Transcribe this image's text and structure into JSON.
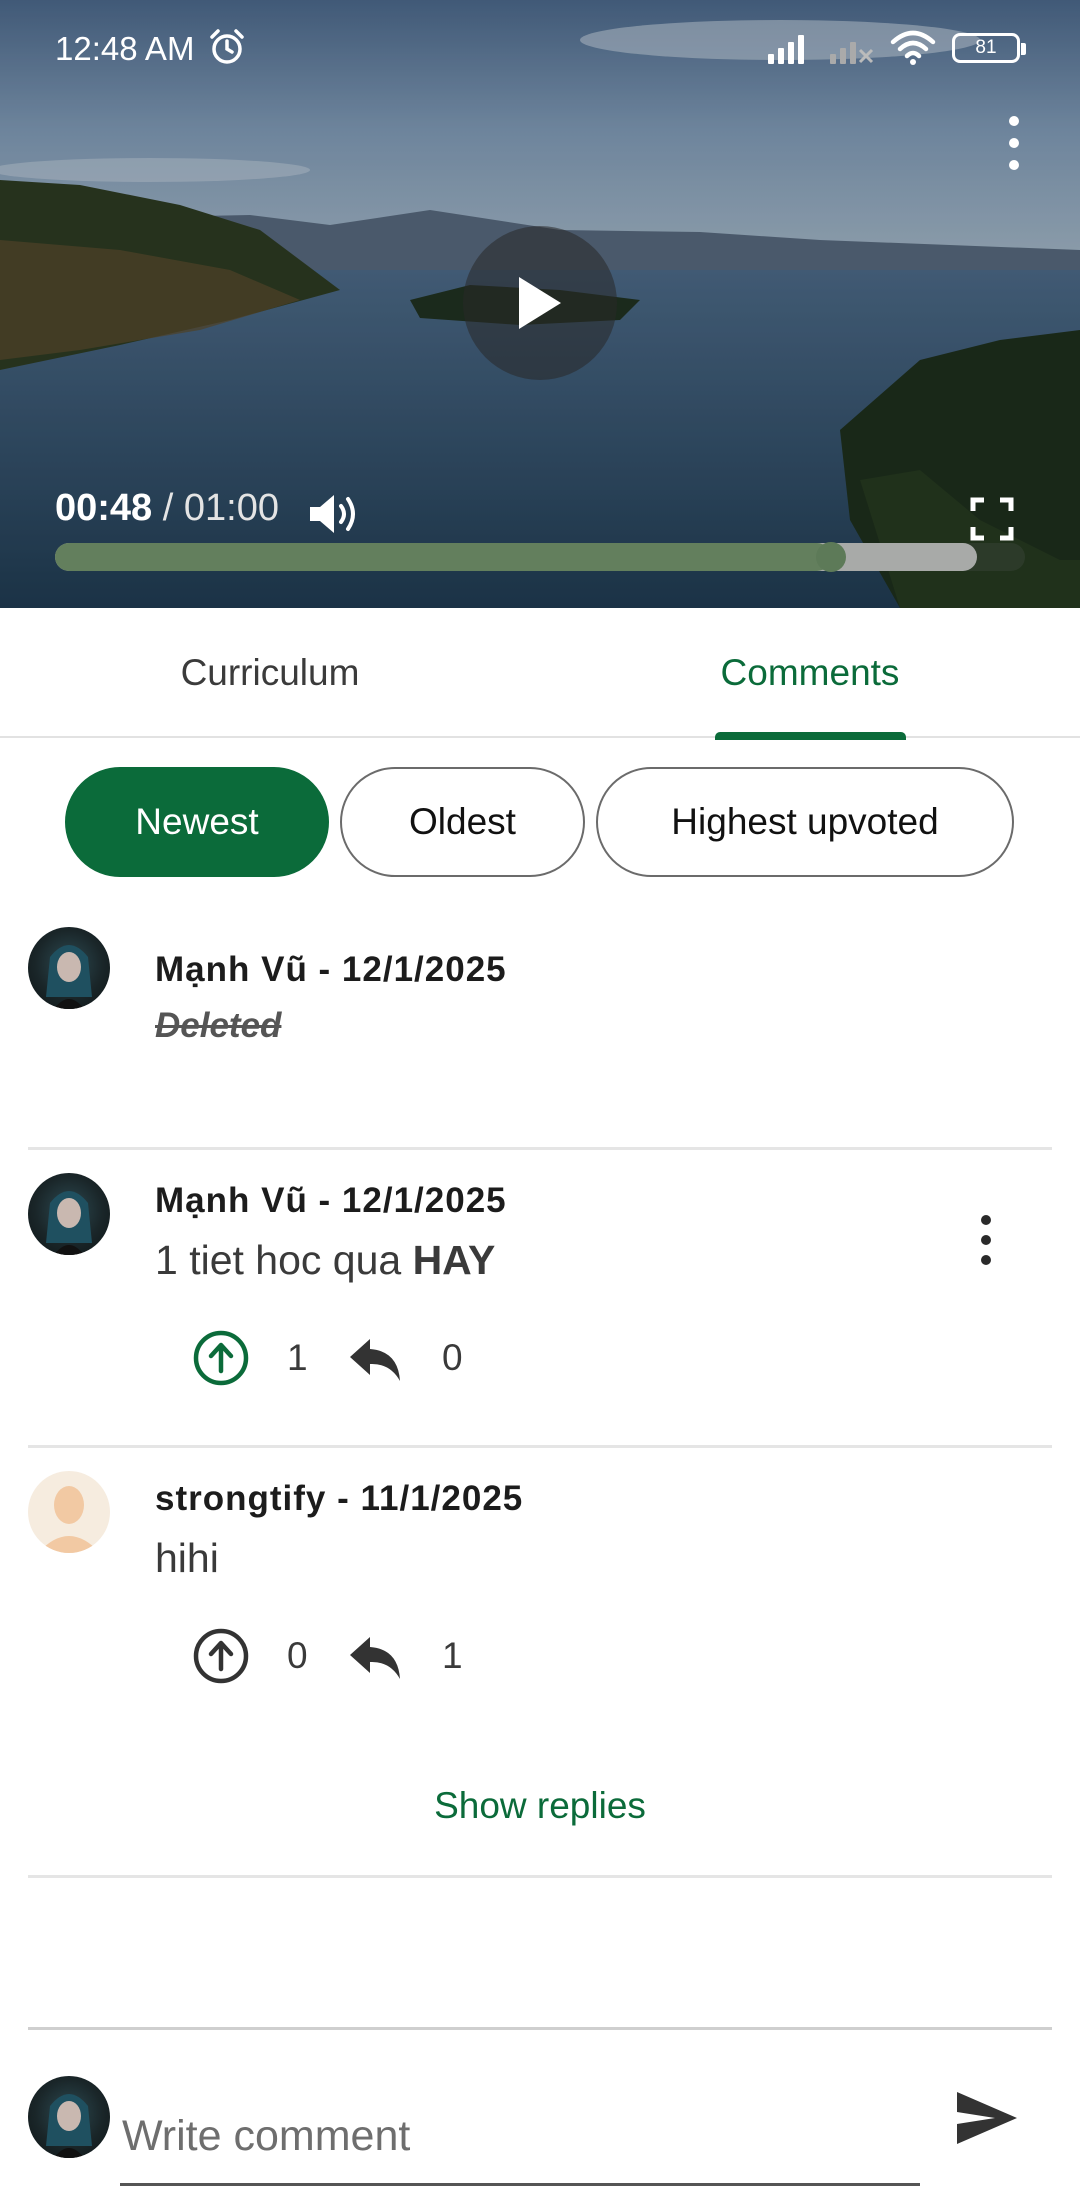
{
  "status_bar": {
    "time": "12:48 AM",
    "battery": "81",
    "icons": [
      "alarm-icon",
      "signal-icon",
      "signal-off-icon",
      "wifi-icon",
      "battery-icon"
    ]
  },
  "video": {
    "current_time": "00:48",
    "separator": " / ",
    "duration": "01:00",
    "progress_fraction": 0.8,
    "buffer_fraction": 0.95
  },
  "tabs": [
    {
      "label": "Curriculum",
      "active": false
    },
    {
      "label": "Comments",
      "active": true
    }
  ],
  "filters": [
    {
      "label": "Newest",
      "selected": true
    },
    {
      "label": "Oldest",
      "selected": false
    },
    {
      "label": "Highest upvoted",
      "selected": false
    }
  ],
  "comments": [
    {
      "meta": "Mạnh Vũ - 12/1/2025",
      "deleted_text": "Deleted"
    },
    {
      "meta": "Mạnh Vũ - 12/1/2025",
      "text_plain": "1 tiet hoc qua ",
      "text_bold": "HAY",
      "upvotes": "1",
      "replies": "0"
    },
    {
      "meta": "strongtify - 11/1/2025",
      "text_plain": "hihi",
      "upvotes": "0",
      "replies": "1"
    }
  ],
  "show_replies_label": "Show replies",
  "composer": {
    "placeholder": "Write comment"
  },
  "colors": {
    "accent": "#0b6b3a",
    "progress": "#637f5d"
  }
}
